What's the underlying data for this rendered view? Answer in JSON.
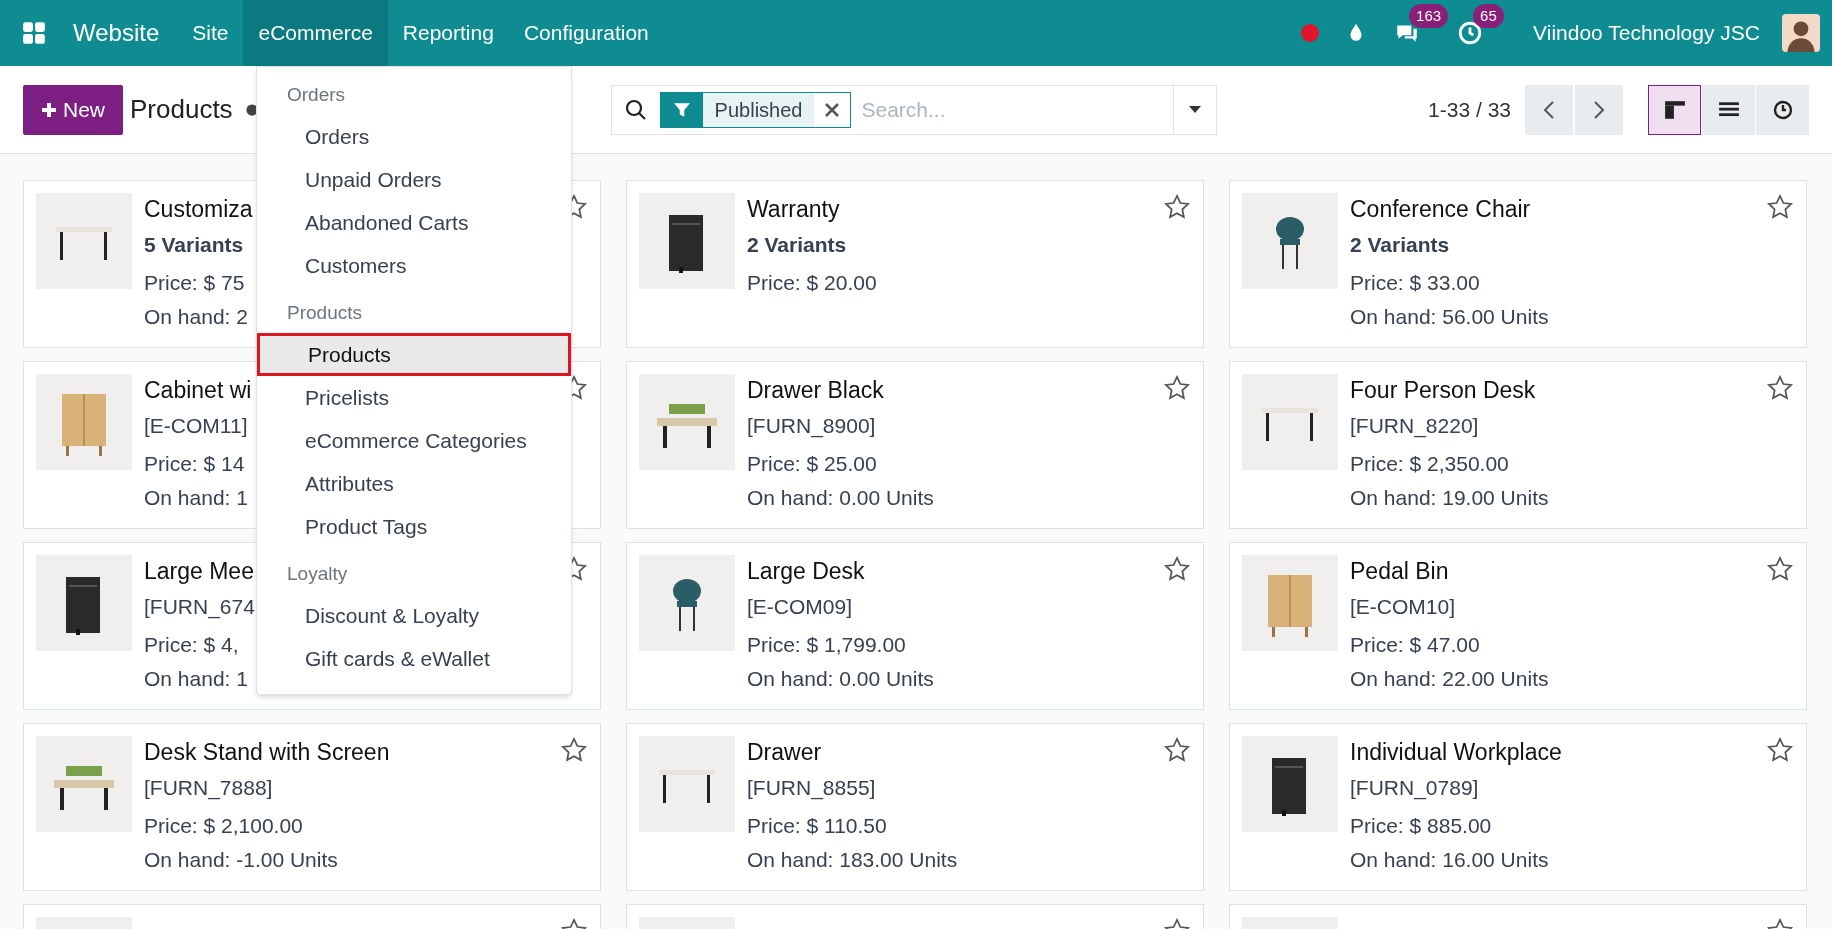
{
  "navbar": {
    "app_name": "Website",
    "menus": [
      {
        "label": "Site",
        "selected": false
      },
      {
        "label": "eCommerce",
        "selected": true
      },
      {
        "label": "Reporting",
        "selected": false
      },
      {
        "label": "Configuration",
        "selected": false
      }
    ],
    "messages_badge": "163",
    "activities_badge": "65",
    "company": "Viindoo Technology JSC"
  },
  "control_panel": {
    "new_button": "New",
    "title": "Products",
    "facet": "Published",
    "search": {
      "placeholder": "Search..."
    },
    "pager": "1-33 / 33",
    "views": [
      {
        "kind": "kanban",
        "selected": true
      },
      {
        "kind": "list",
        "selected": false
      },
      {
        "kind": "activity",
        "selected": false
      }
    ]
  },
  "dropdown": {
    "sections": [
      {
        "heading": "Orders",
        "items": [
          {
            "label": "Orders",
            "selected": false
          },
          {
            "label": "Unpaid Orders",
            "selected": false
          },
          {
            "label": "Abandoned Carts",
            "selected": false
          },
          {
            "label": "Customers",
            "selected": false
          }
        ]
      },
      {
        "heading": "Products",
        "items": [
          {
            "label": "Products",
            "selected": true
          },
          {
            "label": "Pricelists",
            "selected": false
          },
          {
            "label": "eCommerce Categories",
            "selected": false
          },
          {
            "label": "Attributes",
            "selected": false
          },
          {
            "label": "Product Tags",
            "selected": false
          }
        ]
      },
      {
        "heading": "Loyalty",
        "items": [
          {
            "label": "Discount & Loyalty",
            "selected": false
          },
          {
            "label": "Gift cards & eWallet",
            "selected": false
          }
        ]
      }
    ]
  },
  "products": [
    {
      "name": "Customiza",
      "detail": "5 Variants",
      "detail_bold": true,
      "price": "Price: $ 75",
      "on_hand": "On hand: 2"
    },
    {
      "name": "Warranty",
      "detail": "2 Variants",
      "detail_bold": true,
      "price": "Price: $ 20.00"
    },
    {
      "name": "Conference Chair",
      "detail": "2 Variants",
      "detail_bold": true,
      "price": "Price: $ 33.00",
      "on_hand": "On hand: 56.00 Units"
    },
    {
      "name": "Cabinet wi",
      "detail": "[E-COM11]",
      "detail_bold": false,
      "price": "Price: $ 14",
      "on_hand": "On hand: 1"
    },
    {
      "name": "Drawer Black",
      "detail": "[FURN_8900]",
      "detail_bold": false,
      "price": "Price: $ 25.00",
      "on_hand": "On hand: 0.00 Units"
    },
    {
      "name": "Four Person Desk",
      "detail": "[FURN_8220]",
      "detail_bold": false,
      "price": "Price: $ 2,350.00",
      "on_hand": "On hand: 19.00 Units"
    },
    {
      "name": "Large Mee",
      "detail": "[FURN_674",
      "detail_bold": false,
      "price": "Price: $ 4,",
      "on_hand": "On hand: 1"
    },
    {
      "name": "Large Desk",
      "detail": "[E-COM09]",
      "detail_bold": false,
      "price": "Price: $ 1,799.00",
      "on_hand": "On hand: 0.00 Units"
    },
    {
      "name": "Pedal Bin",
      "detail": "[E-COM10]",
      "detail_bold": false,
      "price": "Price: $ 47.00",
      "on_hand": "On hand: 22.00 Units"
    },
    {
      "name": "Desk Stand with Screen",
      "detail": "[FURN_7888]",
      "detail_bold": false,
      "price": "Price: $ 2,100.00",
      "on_hand": "On hand: -1.00 Units"
    },
    {
      "name": "Drawer",
      "detail": "[FURN_8855]",
      "detail_bold": false,
      "price": "Price: $ 110.50",
      "on_hand": "On hand: 183.00 Units"
    },
    {
      "name": "Individual Workplace",
      "detail": "[FURN_0789]",
      "detail_bold": false,
      "price": "Price: $ 885.00",
      "on_hand": "On hand: 16.00 Units"
    }
  ]
}
